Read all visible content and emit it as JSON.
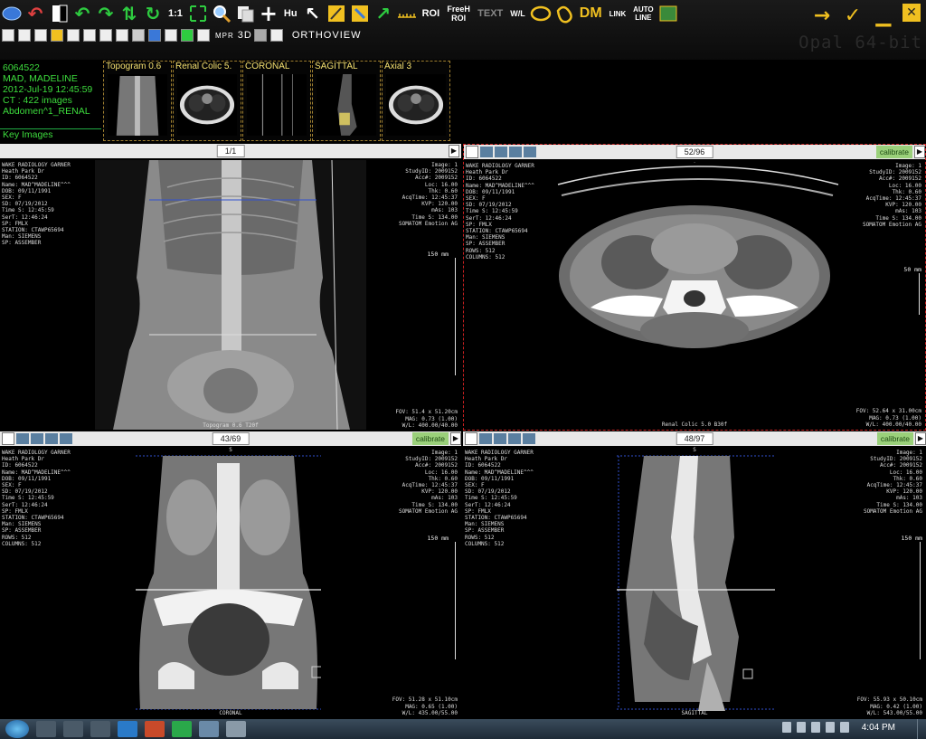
{
  "toolbar": {
    "row2_label": "ORTHOVIEW",
    "hu_label": "Hu",
    "roi_label": "ROI",
    "freeh_roi_label": "FreeH ROI",
    "text_label": "TEXT",
    "wl_label": "W/L",
    "dm_label": "DM",
    "link_label": "LINK",
    "autoline_label": "AUTO LINE",
    "mpr_label": "MPR",
    "threed_label": "3D",
    "onetoone_label": "1:1",
    "watermark": "Opal 64-bit"
  },
  "patient": {
    "id": "6064522",
    "name": "MAD, MADELINE",
    "datetime": "2012-Jul-19 12:45:59",
    "images": "CT : 422 images",
    "study": "Abdomen^1_RENAL",
    "key_images": "Key Images"
  },
  "series": [
    {
      "label": "Topogram  0.6"
    },
    {
      "label": "Renal Colic  5."
    },
    {
      "label": "CORONAL"
    },
    {
      "label": "SAGITTAL"
    },
    {
      "label": "Axial 3"
    }
  ],
  "viewports": {
    "topogram": {
      "counter": "1/1",
      "ruler": "150 mm",
      "bottom": "Topogram  0.6  T20f",
      "fov": "FOV: 51.4 x 51.20cm",
      "mag": "MAG: 0.73 (1.00)",
      "wl": "W/L: 400.00/40.00"
    },
    "axial": {
      "counter": "52/96",
      "calibrate": "calibrate",
      "orient": "A",
      "ruler": "50 mm",
      "bottom": "Renal Colic  5.0  B30f",
      "fov": "FOV: 52.64 x 31.00cm",
      "mag": "MAG: 0.73 (1.00)",
      "wl": "W/L: 400.00/40.00"
    },
    "coronal": {
      "counter": "43/69",
      "calibrate": "calibrate",
      "orient": "S",
      "ruler": "150 mm",
      "bottom": "CORONAL",
      "fov": "FOV: 51.28 x 51.10cm",
      "mag": "MAG: 0.65 (1.00)",
      "wl": "W/L: 435.00/55.00"
    },
    "sagittal": {
      "counter": "48/97",
      "calibrate": "calibrate",
      "orient": "S",
      "ruler": "150 mm",
      "bottom": "SAGITTAL",
      "fov": "FOV: 55.93 x 50.10cm",
      "mag": "MAG: 0.42 (1.00)",
      "wl": "W/L: 543.00/55.00"
    }
  },
  "overlay_left": [
    "WAKE RADIOLOGY GARNER",
    "Heath Park Dr",
    "ID: 6064522",
    "Name: MAD^MADELINE^^^",
    "DOB: 09/11/1991",
    "SEX: F",
    "SD: 07/19/2012",
    "Time S: 12:45:59",
    "SerT: 12:46:24",
    "SP: FMLX",
    "STATION: CTAWP65694",
    "Man: SIEMENS",
    "SP: ASSEMBER",
    "ROWS: 512",
    "COLUMNS: 512"
  ],
  "overlay_right": [
    "Image: 1",
    "StudyID: 2009152",
    "Acc#: 2009152",
    "Loc: 16.00",
    "Thk: 0.60",
    "AcqTime: 12:45:37",
    "KVP: 120.00",
    "mAs: 103",
    "Time S: 134.00",
    "SOMATOM Emotion AG"
  ],
  "taskbar": {
    "clock": "4:04 PM"
  }
}
